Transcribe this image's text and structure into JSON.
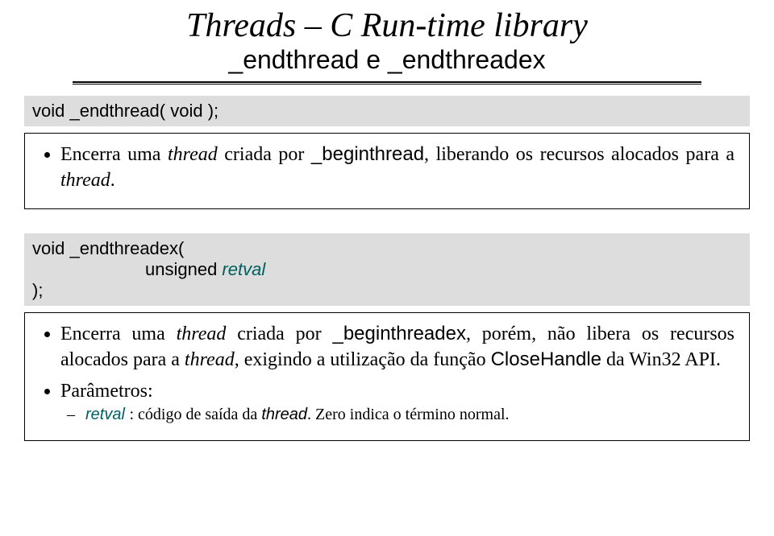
{
  "header": {
    "title": "Threads – C Run-time library",
    "subtitle": "_endthread e _endthreadex"
  },
  "block1": {
    "code": "void  _endthread( void );",
    "bullet": {
      "pre": "Encerra uma ",
      "ital1": "thread",
      "mid1": " criada por ",
      "func": "_beginthread",
      "mid2": ", liberando os recursos alocados para a ",
      "ital2": "thread",
      "end": "."
    }
  },
  "block2": {
    "code_l1": "void  _endthreadex(",
    "code_l2_kw": "unsigned ",
    "code_l2_param": "retval",
    "code_l3": ");",
    "bullets": {
      "b1": {
        "pre": "Encerra uma ",
        "ital1": "thread",
        "mid1": " criada por ",
        "func": "_beginthreadex",
        "mid2": ", porém, não libera os recursos alocados para a ",
        "ital2": "thread",
        "mid3": ", exigindo a utilização da função ",
        "func2": "CloseHandle",
        "end": " da Win32 API."
      },
      "b2_label": "Parâmetros:",
      "b2_sub": {
        "param": "retval ",
        "text1": ": código de saída da ",
        "ital": "thread",
        "text2": ". Zero indica o término normal."
      }
    }
  }
}
